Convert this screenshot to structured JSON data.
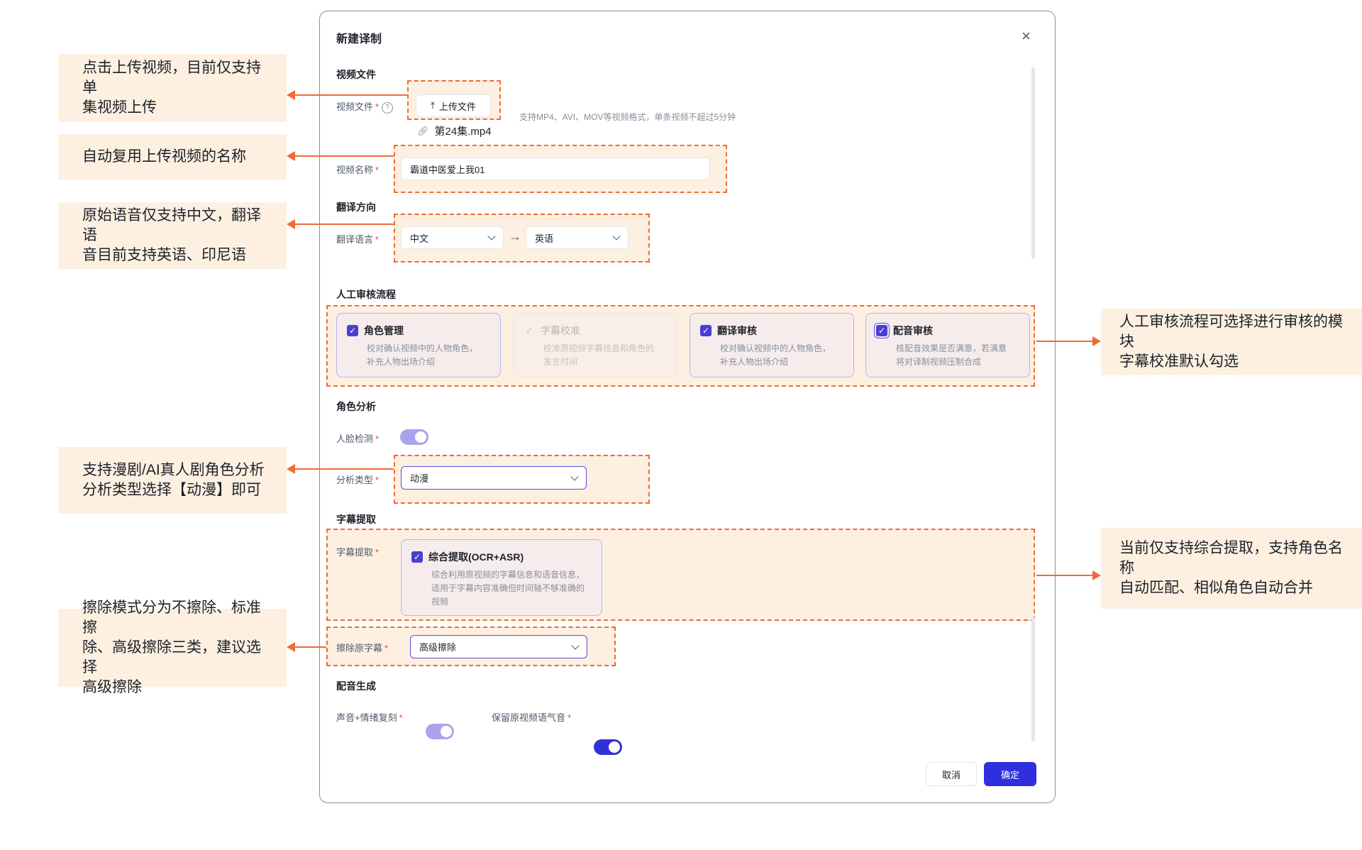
{
  "dialog": {
    "title": "新建译制",
    "close_icon": "close-icon"
  },
  "video_file": {
    "section": "视频文件",
    "label": "视频文件",
    "upload_label": "上传文件",
    "hint": "支持MP4、AVI、MOV等视频格式，单条视频不超过5分钟",
    "file_name": "第24集.mp4"
  },
  "video_name": {
    "label": "视频名称",
    "value": "霸道中医爱上我01"
  },
  "translation": {
    "section": "翻译方向",
    "label": "翻译语言",
    "source": "中文",
    "target": "英语"
  },
  "review": {
    "section": "人工审核流程",
    "cards": [
      {
        "title": "角色管理",
        "desc": "校对确认视频中的人物角色，\n补充人物出场介绍",
        "checked": true,
        "disabled": false
      },
      {
        "title": "字幕校准",
        "desc": "校准原视频字幕信息和角色的\n发言时间",
        "checked": true,
        "disabled": true
      },
      {
        "title": "翻译审核",
        "desc": "校对确认视频中的人物角色，\n补充人物出场介绍",
        "checked": true,
        "disabled": false
      },
      {
        "title": "配音审核",
        "desc": "核配音效果是否满意，若满意\n将对译制视频压制合成",
        "checked": true,
        "disabled": false
      }
    ]
  },
  "role_analysis": {
    "section": "角色分析",
    "face_label": "人脸检测",
    "face_on": true,
    "type_label": "分析类型",
    "type_value": "动漫"
  },
  "subtitle": {
    "section": "字幕提取",
    "label": "字幕提取",
    "option_title": "综合提取(OCR+ASR)",
    "option_desc": "综合利用原视频的字幕信息和语音信息，\n适用于字幕内容准确但时间轴不够准确的\n视频",
    "erase_label": "擦除原字幕",
    "erase_value": "高级擦除"
  },
  "dubbing": {
    "section": "配音生成",
    "voice_label": "声音+情绪复刻",
    "voice_on": true,
    "keep_label": "保留原视频语气音",
    "keep_on": true
  },
  "footer": {
    "cancel": "取消",
    "ok": "确定"
  },
  "notes": {
    "upload": "点击上传视频，目前仅支持单\n集视频上传",
    "name": "自动复用上传视频的名称",
    "lang": "原始语音仅支持中文，翻译语\n音目前支持英语、印尼语",
    "review": "人工审核流程可选择进行审核的模块\n字幕校准默认勾选",
    "role": "支持漫剧/AI真人剧角色分析\n分析类型选择【动漫】即可",
    "subtitle": "当前仅支持综合提取，支持角色名称\n自动匹配、相似角色自动合并",
    "erase": "擦除模式分为不擦除、标准擦\n除、高级擦除三类，建议选择\n高级擦除"
  },
  "colors": {
    "accent": "#2f2fe0",
    "highlight_border": "#f06a35",
    "note_bg": "#fdf0e1"
  }
}
